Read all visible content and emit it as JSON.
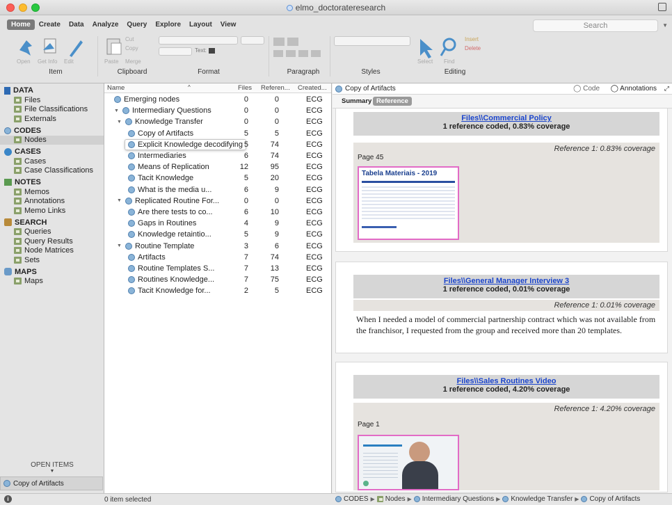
{
  "window": {
    "title": "elmo_doctorateresearch"
  },
  "ribbon": {
    "tabs": [
      "Home",
      "Create",
      "Data",
      "Analyze",
      "Query",
      "Explore",
      "Layout",
      "View"
    ],
    "search_placeholder": "Search",
    "groups": {
      "item": "Item",
      "clipboard": "Clipboard",
      "format": "Format",
      "paragraph": "Paragraph",
      "styles": "Styles",
      "editing": "Editing"
    },
    "item_buttons": [
      "Open",
      "Get Info",
      "Edit"
    ],
    "clipboard_buttons": {
      "paste": "Paste",
      "cut": "Cut",
      "copy": "Copy",
      "merge": "Merge"
    },
    "format_text_label": "Text:",
    "editing_buttons": {
      "insert": "Insert",
      "delete": "Delete",
      "select": "Select",
      "find": "Find"
    }
  },
  "sidebar": {
    "sections": [
      {
        "label": "DATA",
        "icon": "data-icon",
        "items": [
          "Files",
          "File Classifications",
          "Externals"
        ]
      },
      {
        "label": "CODES",
        "icon": "codes-icon",
        "items": [
          "Nodes"
        ]
      },
      {
        "label": "CASES",
        "icon": "cases-icon",
        "items": [
          "Cases",
          "Case Classifications"
        ]
      },
      {
        "label": "NOTES",
        "icon": "notes-icon",
        "items": [
          "Memos",
          "Annotations",
          "Memo Links"
        ]
      },
      {
        "label": "SEARCH",
        "icon": "search-icon",
        "items": [
          "Queries",
          "Query Results",
          "Node Matrices",
          "Sets"
        ]
      },
      {
        "label": "MAPS",
        "icon": "maps-icon",
        "items": [
          "Maps"
        ]
      }
    ],
    "selected": "Nodes",
    "open_items_label": "OPEN ITEMS",
    "open_item": "Copy of Artifacts"
  },
  "list": {
    "columns": [
      "Name",
      "Files",
      "Referen...",
      "Created..."
    ],
    "rows": [
      {
        "name": "Emerging nodes",
        "files": "0",
        "refs": "0",
        "by": "ECG",
        "level": 0,
        "expanded": null
      },
      {
        "name": "Intermediary Questions",
        "files": "0",
        "refs": "0",
        "by": "ECG",
        "level": 0,
        "expanded": true
      },
      {
        "name": "Knowledge Transfer",
        "files": "0",
        "refs": "0",
        "by": "ECG",
        "level": 1,
        "expanded": true
      },
      {
        "name": "Copy of Artifacts",
        "files": "5",
        "refs": "5",
        "by": "ECG",
        "level": 2,
        "expanded": null
      },
      {
        "name": "Explicit Knowledge decodifying",
        "files": "5",
        "refs": "74",
        "by": "ECG",
        "level": 2,
        "expanded": null,
        "selected": true
      },
      {
        "name": "Intermediaries",
        "files": "6",
        "refs": "74",
        "by": "ECG",
        "level": 2,
        "expanded": null
      },
      {
        "name": "Means of Replication",
        "files": "12",
        "refs": "95",
        "by": "ECG",
        "level": 2,
        "expanded": null
      },
      {
        "name": "Tacit Knowledge",
        "files": "5",
        "refs": "20",
        "by": "ECG",
        "level": 2,
        "expanded": null
      },
      {
        "name": "What is the media u...",
        "files": "6",
        "refs": "9",
        "by": "ECG",
        "level": 2,
        "expanded": null
      },
      {
        "name": "Replicated Routine For...",
        "files": "0",
        "refs": "0",
        "by": "ECG",
        "level": 1,
        "expanded": true
      },
      {
        "name": "Are there tests to co...",
        "files": "6",
        "refs": "10",
        "by": "ECG",
        "level": 2,
        "expanded": null
      },
      {
        "name": "Gaps in Routines",
        "files": "4",
        "refs": "9",
        "by": "ECG",
        "level": 2,
        "expanded": null
      },
      {
        "name": "Knowledge retaintio...",
        "files": "5",
        "refs": "9",
        "by": "ECG",
        "level": 2,
        "expanded": null
      },
      {
        "name": "Routine Template",
        "files": "3",
        "refs": "6",
        "by": "ECG",
        "level": 1,
        "expanded": true
      },
      {
        "name": "Artifacts",
        "files": "7",
        "refs": "74",
        "by": "ECG",
        "level": 2,
        "expanded": null
      },
      {
        "name": "Routine Templates S...",
        "files": "7",
        "refs": "13",
        "by": "ECG",
        "level": 2,
        "expanded": null
      },
      {
        "name": "Routines Knowledge...",
        "files": "7",
        "refs": "75",
        "by": "ECG",
        "level": 2,
        "expanded": null
      },
      {
        "name": "Tacit Knowledge for...",
        "files": "2",
        "refs": "5",
        "by": "ECG",
        "level": 2,
        "expanded": null
      }
    ]
  },
  "detail": {
    "title": "Copy of Artifacts",
    "code_label": "Code",
    "annotations_label": "Annotations",
    "tabs": [
      "Summary",
      "Reference"
    ],
    "active_tab": "Reference",
    "cards": [
      {
        "source": "Files\\\\Commercial Policy",
        "summary": "1 reference coded, 0.83% coverage",
        "ref": "Reference 1: 0.83% coverage",
        "page": "Page 45",
        "thumb_title": "Tabela Materiais - 2019"
      },
      {
        "source": "Files\\\\General Manager Interview 3",
        "summary": "1 reference coded, 0.01% coverage",
        "ref": "Reference 1: 0.01% coverage",
        "quote": "When I needed a model of commercial partnership contract which was not available from the franchisor, I requested from the group and received more than 20 templates."
      },
      {
        "source": "Files\\\\Sales Routines Video",
        "summary": "1 reference coded, 4.20% coverage",
        "ref": "Reference 1: 4.20% coverage",
        "page": "Page 1"
      }
    ]
  },
  "status": {
    "left": "0 item selected",
    "breadcrumbs": [
      "CODES",
      "Nodes",
      "Intermediary Questions",
      "Knowledge Transfer",
      "Copy of Artifacts"
    ]
  },
  "colors": {
    "accent": "#3a86c8",
    "highlight_border": "#e26bc6",
    "link": "#1a44cc"
  }
}
